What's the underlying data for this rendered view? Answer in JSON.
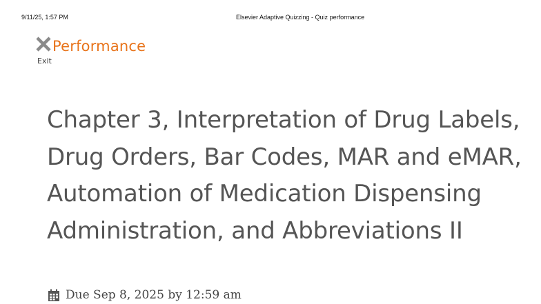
{
  "print_header": {
    "datetime": "9/11/25, 1:57 PM",
    "document_title": "Elsevier Adaptive Quizzing - Quiz performance"
  },
  "header": {
    "exit_icon": "close-x-icon",
    "exit_label": "Exit",
    "page_heading": "Performance",
    "accent_color": "#e8731a"
  },
  "quiz": {
    "title": "Chapter 3, Interpretation of Drug Labels, Drug Orders, Bar Codes, MAR and eMAR, Automation of Medication Dispensing Administration, and Abbreviations II",
    "due_icon": "calendar-icon",
    "due_text": "Due Sep 8, 2025 by 12:59 am"
  }
}
